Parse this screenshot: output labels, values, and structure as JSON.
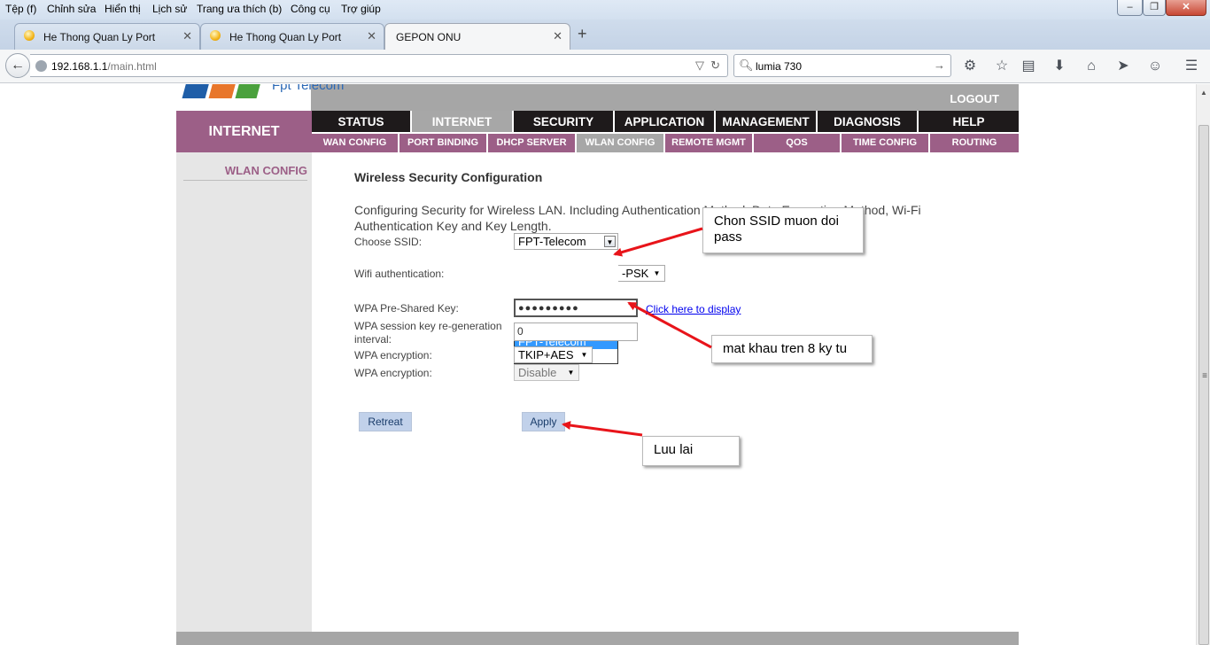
{
  "browser": {
    "menu": [
      "Tệp (f)",
      "Chỉnh sửa",
      "Hiển thị",
      "Lịch sử",
      "Trang ưa thích (b)",
      "Công cụ",
      "Trợ giúp"
    ],
    "window_controls": {
      "minimize": "–",
      "maximize": "❐",
      "close": "✕"
    },
    "tabs": [
      {
        "title": "He Thong Quan Ly Port",
        "active": false
      },
      {
        "title": "He Thong Quan Ly Port",
        "active": false
      },
      {
        "title": "GEPON ONU",
        "active": true
      }
    ],
    "new_tab": "+",
    "url": {
      "host": "192.168.1.1",
      "path": "/main.html"
    },
    "search": {
      "value": "lumia 730"
    },
    "toolbar_icons": [
      "extension-icon",
      "bookmark-star-icon",
      "reading-list-icon",
      "downloads-icon",
      "home-icon",
      "send-icon",
      "smiley-icon",
      "menu-icon"
    ]
  },
  "router": {
    "logo_text": "Fpt Telecom",
    "logout": "LOGOUT",
    "section_title": "INTERNET",
    "left_menu": [
      "WLAN CONFIG"
    ],
    "main_tabs": [
      "STATUS",
      "INTERNET",
      "SECURITY",
      "APPLICATION",
      "MANAGEMENT",
      "DIAGNOSIS",
      "HELP"
    ],
    "active_main_tab": "INTERNET",
    "sub_tabs": [
      "WAN CONFIG",
      "PORT BINDING",
      "DHCP SERVER",
      "WLAN CONFIG",
      "REMOTE MGMT",
      "QOS",
      "TIME CONFIG",
      "ROUTING"
    ],
    "active_sub_tab": "WLAN CONFIG"
  },
  "form": {
    "title": "Wireless Security Configuration",
    "description": "Configuring Security for Wireless LAN. Including Authentication Method, Data Encryption Method, Wi-Fi Authentication Key and Key Length.",
    "choose_ssid": {
      "label": "Choose SSID:",
      "value": "FPT-Telecom",
      "options": [
        "FPT-Telecom",
        "FPT-Telecom2"
      ]
    },
    "wifi_auth": {
      "label": "Wifi authentication:",
      "value_suffix": "-PSK"
    },
    "psk": {
      "label": "WPA Pre-Shared Key:",
      "value": "●●●●●●●●●",
      "link": "Click here to display"
    },
    "rekey": {
      "label": "WPA session key re-generation interval:",
      "value": "0"
    },
    "encryption": {
      "label": "WPA encryption:",
      "value": "TKIP+AES"
    },
    "encryption2": {
      "label": "WPA encryption:",
      "value": "Disable"
    },
    "retreat": "Retreat",
    "apply": "Apply"
  },
  "annotations": {
    "ssid_note": "Chon SSID muon doi pass",
    "password_note": "mat khau tren 8 ky tu",
    "save_note": "Luu lai",
    "arrow_color": "#e8141a"
  }
}
